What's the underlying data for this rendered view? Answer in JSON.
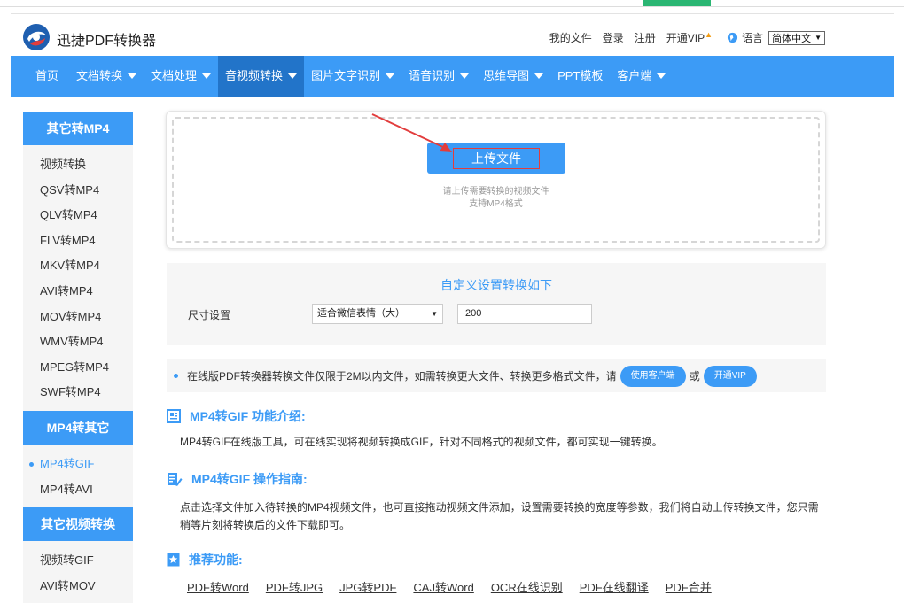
{
  "colors": {
    "accent": "#3c9bf6",
    "nav_active": "#2274c9",
    "arrow": "#e23d3d",
    "topbar_green": "#2bb673"
  },
  "brand": {
    "name": "迅捷PDF转换器",
    "logo_icon": "xunjie-logo-icon"
  },
  "toplinks": {
    "my_files": "我的文件",
    "login": "登录",
    "register": "注册",
    "vip": "开通VIP",
    "vip_badge": "fire-icon",
    "lang_label": "语言",
    "lang_value": "简体中文"
  },
  "nav": {
    "items": [
      {
        "label": "首页",
        "dropdown": false
      },
      {
        "label": "文档转换",
        "dropdown": true
      },
      {
        "label": "文档处理",
        "dropdown": true
      },
      {
        "label": "音视频转换",
        "dropdown": true,
        "active": true
      },
      {
        "label": "图片文字识别",
        "dropdown": true
      },
      {
        "label": "语音识别",
        "dropdown": true
      },
      {
        "label": "思维导图",
        "dropdown": true
      },
      {
        "label": "PPT模板",
        "dropdown": false
      },
      {
        "label": "客户端",
        "dropdown": true
      }
    ]
  },
  "sidebar": {
    "groups": [
      {
        "title": "其它转MP4",
        "items": [
          "视频转换",
          "QSV转MP4",
          "QLV转MP4",
          "FLV转MP4",
          "MKV转MP4",
          "AVI转MP4",
          "MOV转MP4",
          "WMV转MP4",
          "MPEG转MP4",
          "SWF转MP4"
        ]
      },
      {
        "title": "MP4转其它",
        "items": [
          "MP4转GIF",
          "MP4转AVI"
        ],
        "active_index": 0
      },
      {
        "title": "其它视频转换",
        "items": [
          "视频转GIF",
          "AVI转MOV"
        ]
      }
    ]
  },
  "upload": {
    "button_label": "上传文件",
    "hint_line1": "请上传需要转换的视频文件",
    "hint_line2": "支持MP4格式"
  },
  "settings": {
    "title": "自定义设置转换如下",
    "size_label": "尺寸设置",
    "size_select_value": "适合微信表情（大）",
    "size_input_value": "200"
  },
  "notice": {
    "text": "在线版PDF转换器转换文件仅限于2M以内文件，如需转换更大文件、转换更多格式文件，请",
    "client_button": "使用客户端",
    "or": "或",
    "vip_button": "开通VIP"
  },
  "intro": {
    "title": "MP4转GIF 功能介绍:",
    "text": "MP4转GIF在线版工具，可在线实现将视频转换成GIF，针对不同格式的视频文件，都可实现一键转换。"
  },
  "guide": {
    "title": "MP4转GIF 操作指南:",
    "text": "点击选择文件加入待转换的MP4视频文件，也可直接拖动视频文件添加，设置需要转换的宽度等参数，我们将自动上传转换文件，您只需稍等片刻将转换后的文件下载即可。"
  },
  "recommend": {
    "title": "推荐功能:",
    "links": [
      "PDF转Word",
      "PDF转JPG",
      "JPG转PDF",
      "CAJ转Word",
      "OCR在线识别",
      "PDF在线翻译",
      "PDF合并"
    ]
  }
}
